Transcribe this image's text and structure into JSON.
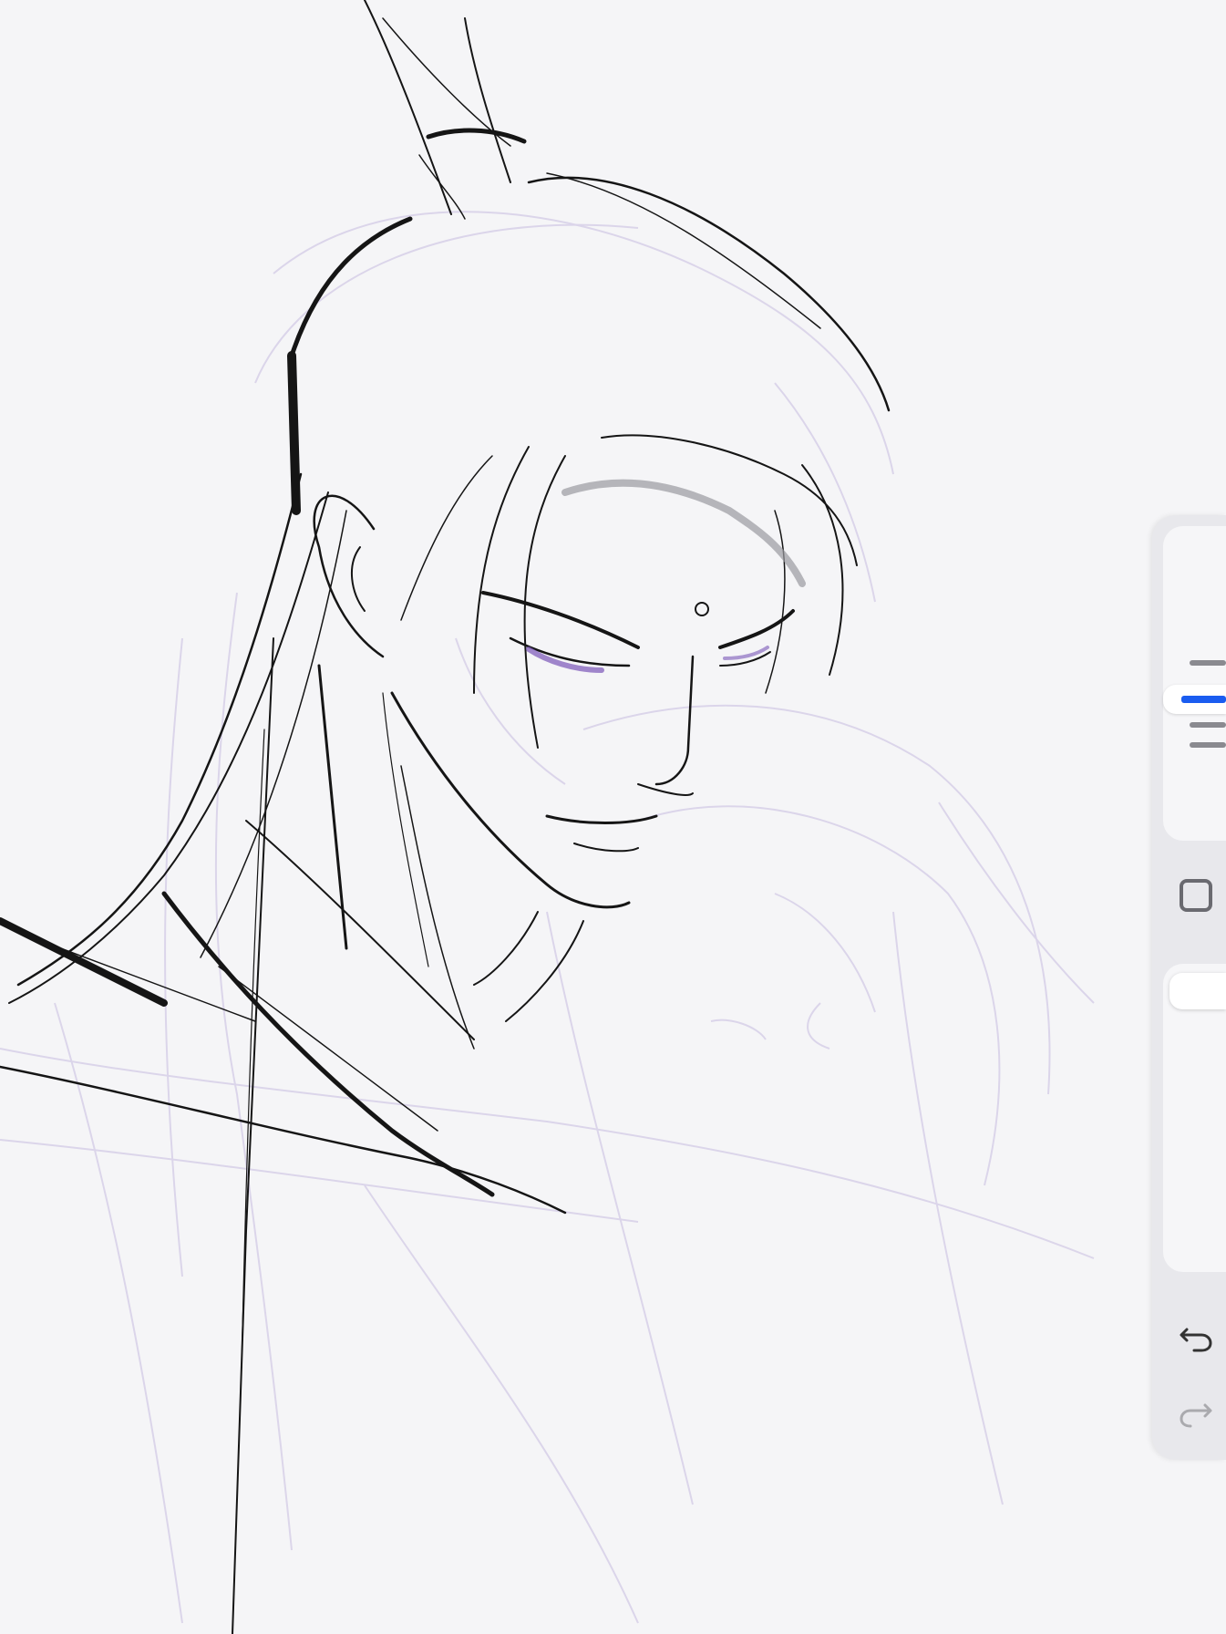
{
  "canvas": {
    "description_icon": "sketch-canvas",
    "ink_color": "#111111",
    "underdrawing_color": "#c9bfe0",
    "accent_color": "#7a56b8"
  },
  "toolbar": {
    "brush_sizes": [
      {
        "name": "size-thin",
        "selected": false
      },
      {
        "name": "size-medium",
        "selected": true
      },
      {
        "name": "size-thick",
        "selected": false
      },
      {
        "name": "size-extra",
        "selected": false
      }
    ],
    "selected_color": "#1a5cf0",
    "shape_tool_icon": "square-icon",
    "opacity_level": 1.0,
    "undo_icon": "undo-icon",
    "redo_icon": "redo-icon",
    "redo_enabled": false
  }
}
